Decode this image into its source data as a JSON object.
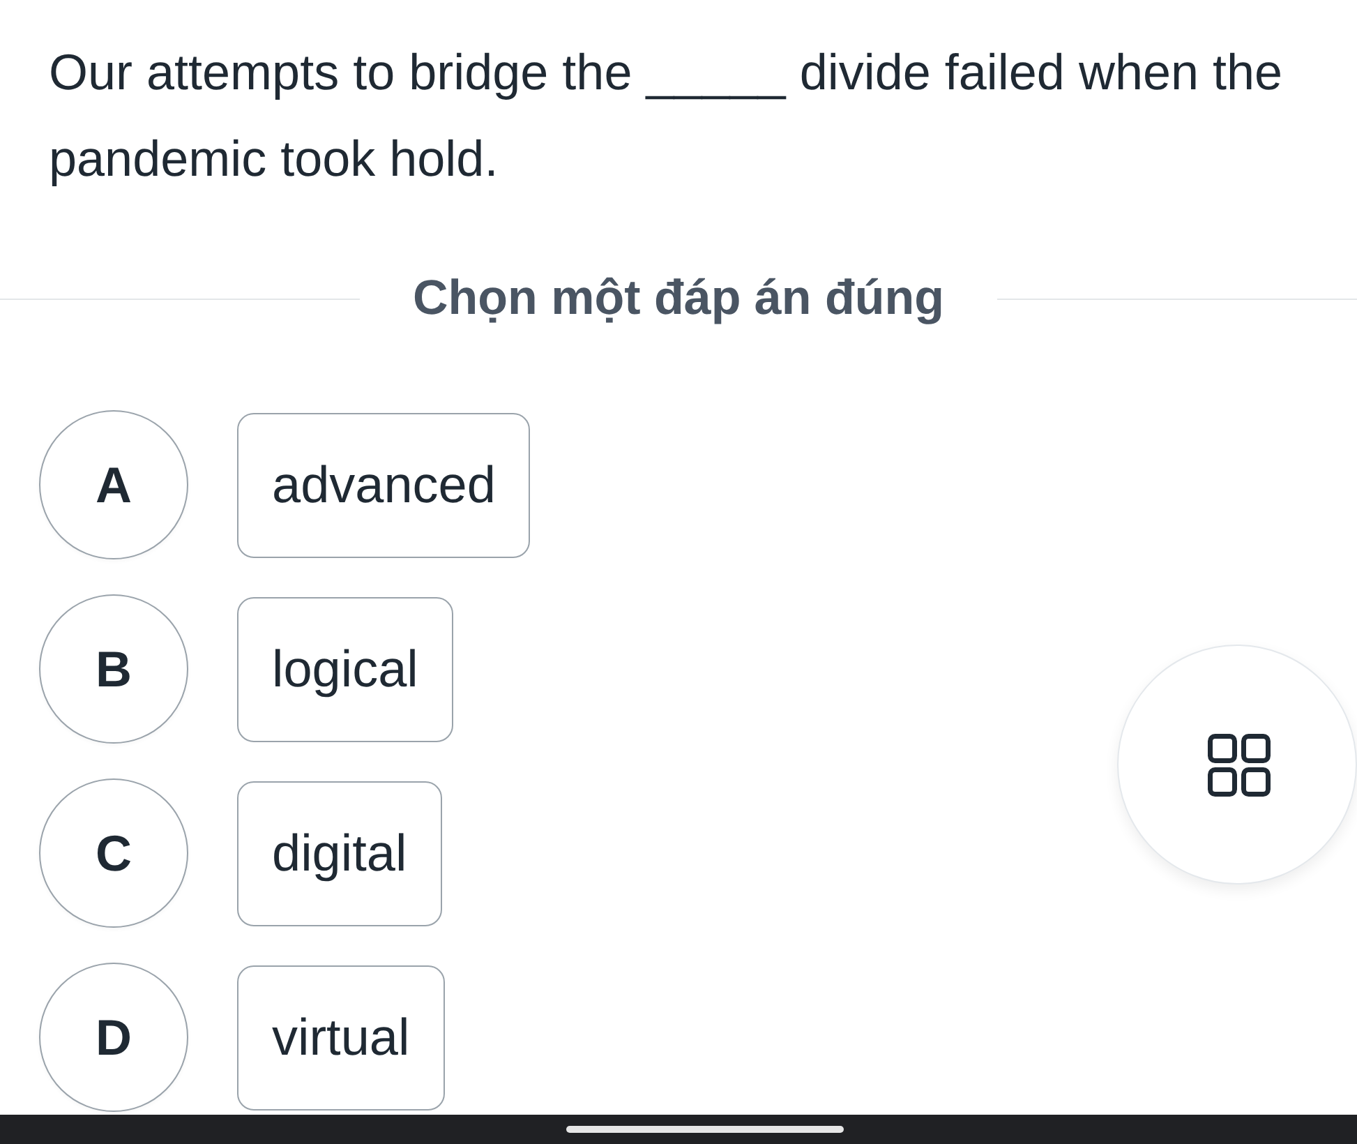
{
  "question": {
    "text": "Our attempts to bridge the _____ divide failed when the pandemic took hold."
  },
  "instruction": "Chọn một đáp án đúng",
  "options": [
    {
      "letter": "A",
      "text": "advanced",
      "selected": false
    },
    {
      "letter": "B",
      "text": "logical",
      "selected": false
    },
    {
      "letter": "C",
      "text": "digital",
      "selected": false
    },
    {
      "letter": "D",
      "text": "virtual",
      "selected": false
    }
  ]
}
